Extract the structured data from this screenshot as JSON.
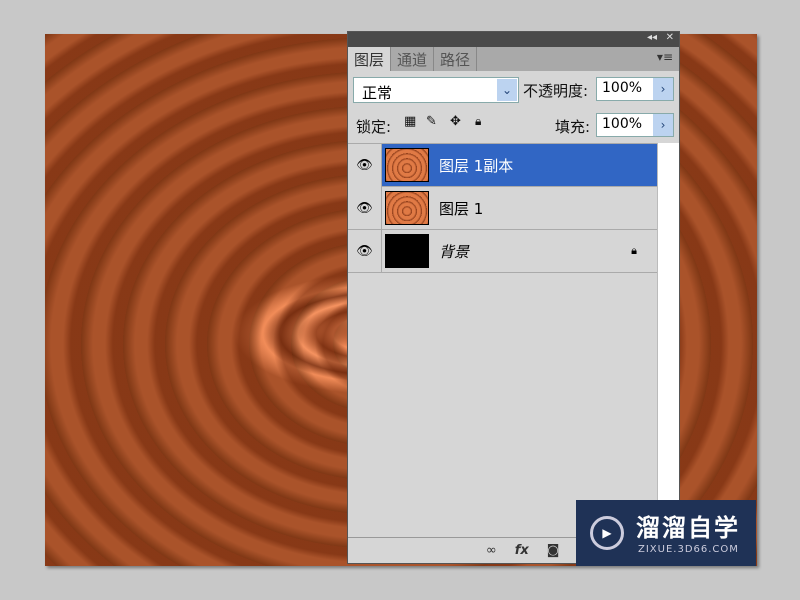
{
  "panel": {
    "tabs": [
      "图层",
      "通道",
      "路径"
    ],
    "blend_mode": "正常",
    "opacity_label": "不透明度:",
    "opacity": "100%",
    "lock_label": "锁定:",
    "fill_label": "填充:",
    "fill": "100%"
  },
  "layers": [
    {
      "name": "图层 1副本",
      "selected": true
    },
    {
      "name": "图层 1",
      "selected": false
    },
    {
      "name": "背景",
      "selected": false,
      "locked": true
    }
  ],
  "watermark": {
    "title": "溜溜自学",
    "url": "ZIXUE.3D66.COM"
  }
}
